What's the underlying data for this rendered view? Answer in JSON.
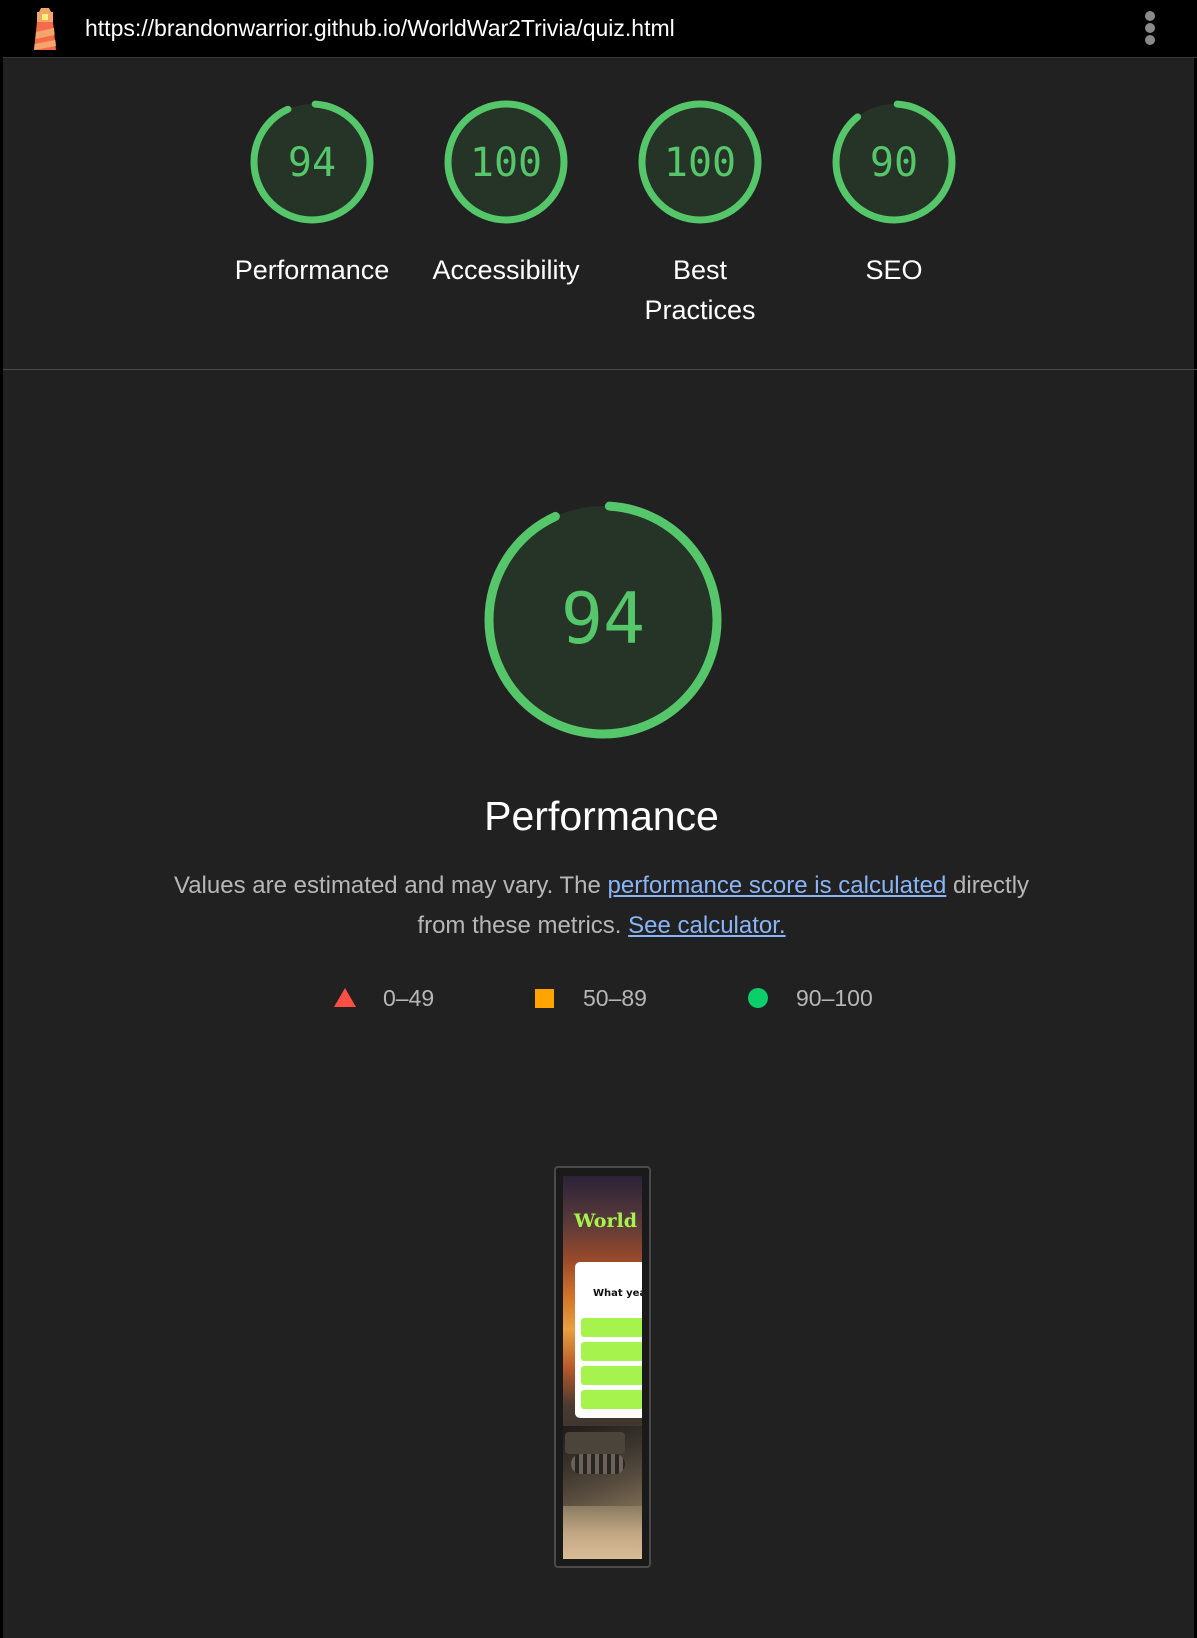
{
  "browser": {
    "url": "https://brandonwarrior.github.io/WorldWar2Trivia/quiz.html"
  },
  "scores": [
    {
      "value": "94",
      "label": "Performance",
      "fraction": 0.94
    },
    {
      "value": "100",
      "label": "Accessibility",
      "fraction": 1.0
    },
    {
      "value": "100",
      "label": "Best Practices",
      "fraction": 1.0
    },
    {
      "value": "90",
      "label": "SEO",
      "fraction": 0.9
    }
  ],
  "performance": {
    "score": "94",
    "fraction": 0.94,
    "title": "Performance",
    "desc_prefix": "Values are estimated and may vary. The ",
    "desc_link": "performance score is calculated",
    "desc_middle": " directly from these metrics. ",
    "calculator_link": "See calculator."
  },
  "legend": [
    {
      "range": "0–49",
      "icon": "triangle-icon",
      "color": "#ff4e42"
    },
    {
      "range": "50–89",
      "icon": "square-icon",
      "color": "#ffa400"
    },
    {
      "range": "90–100",
      "icon": "circle-icon",
      "color": "#0cce6b"
    }
  ],
  "thumbnail": {
    "title": "World W",
    "question": "What year d"
  },
  "colors": {
    "pass": "#55c76a",
    "pass_fill": "#263327",
    "link": "#8ab4f8",
    "background": "#212121"
  }
}
